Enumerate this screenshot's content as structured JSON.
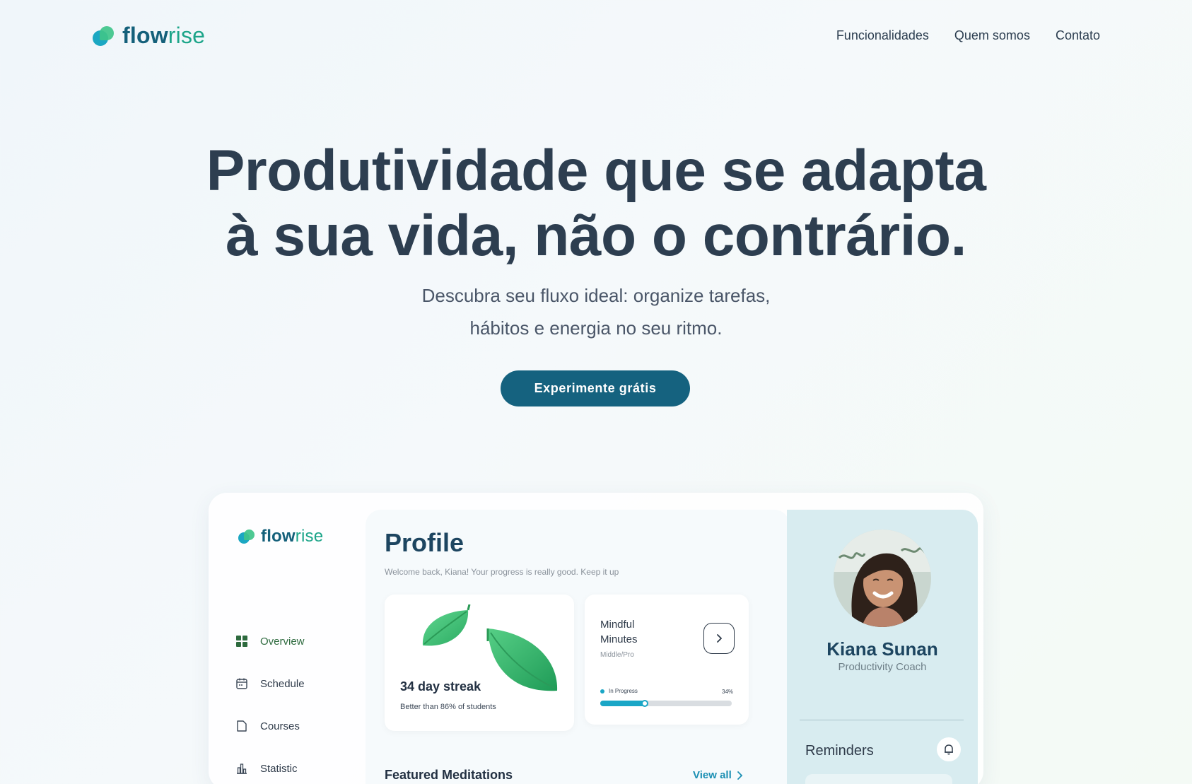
{
  "brand": {
    "name_bold": "flow",
    "name_light": "rise"
  },
  "nav": {
    "links": [
      "Funcionalidades",
      "Quem somos",
      "Contato"
    ]
  },
  "hero": {
    "title_line1": "Produtividade que se adapta",
    "title_line2": "à sua vida, não o contrário.",
    "subtitle_line1": "Descubra seu fluxo ideal: organize tarefas,",
    "subtitle_line2": "hábitos e energia no seu ritmo.",
    "cta_label": "Experimente grátis"
  },
  "app": {
    "sidebar": {
      "items": [
        {
          "label": "Overview",
          "icon": "grid-icon",
          "active": true
        },
        {
          "label": "Schedule",
          "icon": "calendar-icon",
          "active": false
        },
        {
          "label": "Courses",
          "icon": "document-icon",
          "active": false
        },
        {
          "label": "Statistic",
          "icon": "bar-chart-icon",
          "active": false
        }
      ]
    },
    "main": {
      "title": "Profile",
      "welcome": "Welcome back, Kiana! Your progress is really good. Keep it up",
      "streak": {
        "title": "34 day streak",
        "subtitle": "Better than 86% of students"
      },
      "mindful": {
        "title": "Mindful Minutes",
        "level": "Middle/Pro",
        "status": "In Progress",
        "percent_label": "34%",
        "progress": 0.34
      },
      "featured_title": "Featured Meditations",
      "view_all_label": "View all"
    },
    "profile": {
      "name": "Kiana Sunan",
      "role": "Productivity Coach",
      "reminders_label": "Reminders"
    }
  },
  "colors": {
    "primary": "#15627f",
    "accent_teal": "#1aa6c6",
    "accent_green": "#3fc48a",
    "heading": "#2d3e50",
    "panel": "#d8ecf0"
  }
}
